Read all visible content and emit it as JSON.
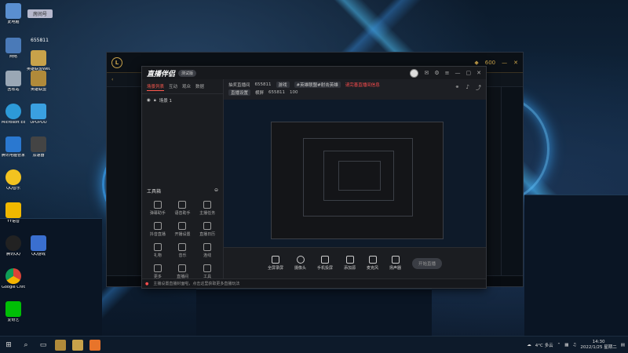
{
  "desktop": {
    "room_badge": "房间号",
    "room_number": "655811",
    "icons": [
      {
        "label": "此电脑"
      },
      {
        "label": "网络"
      },
      {
        "label": "英雄联盟WeGame版"
      },
      {
        "label": "回收站"
      },
      {
        "label": "英雄联盟"
      },
      {
        "label": "Microsoft Edge"
      },
      {
        "label": "UPUPOO"
      },
      {
        "label": "腾讯电脑管家"
      },
      {
        "label": "加速器"
      },
      {
        "label": "QQ音乐"
      },
      {
        "label": "YY语音"
      },
      {
        "label": "腾讯QQ"
      },
      {
        "label": "QQ游戏"
      },
      {
        "label": "Google Chrome"
      },
      {
        "label": "爱奇艺"
      }
    ]
  },
  "game_window": {
    "currency": "600"
  },
  "app": {
    "logo": "直播伴侣",
    "version_badge": "测试版",
    "tabs": [
      {
        "label": "场景列表"
      },
      {
        "label": "互动"
      },
      {
        "label": "观众"
      },
      {
        "label": "数据"
      }
    ],
    "scene_label": "场景 1",
    "tools_header": "工具箱",
    "tools": [
      {
        "label": "弹幕助手"
      },
      {
        "label": "语音助手"
      },
      {
        "label": "主播任务"
      },
      {
        "label": "抖音直播"
      },
      {
        "label": "开播设置"
      },
      {
        "label": "直播日历"
      },
      {
        "label": "礼物"
      },
      {
        "label": "音乐"
      },
      {
        "label": "连线"
      },
      {
        "label": "更多"
      },
      {
        "label": "直播间"
      },
      {
        "label": "工具"
      }
    ],
    "info": {
      "room_label": "抽奖直播间",
      "room_id": "655811",
      "tag": "游戏",
      "category": "#英雄联盟#射击英雄",
      "warning": "请完善直播间信息",
      "sub_left": "直播设置",
      "sub_mode": "横屏",
      "sub_id": "655811",
      "sub_count": "100"
    },
    "bottom_buttons": [
      {
        "label": "全屏录屏"
      },
      {
        "label": "摄像头"
      },
      {
        "label": "手机投屏"
      },
      {
        "label": "添加源"
      },
      {
        "label": "麦克风"
      },
      {
        "label": "扬声器"
      }
    ],
    "start_live": "开始直播",
    "status_text": "主播设置直播封面啦，点击这里获取更多直播玩法"
  },
  "taskbar": {
    "weather": "4°C 多云",
    "time": "14:30",
    "date": "2022/1/25 星期二"
  }
}
